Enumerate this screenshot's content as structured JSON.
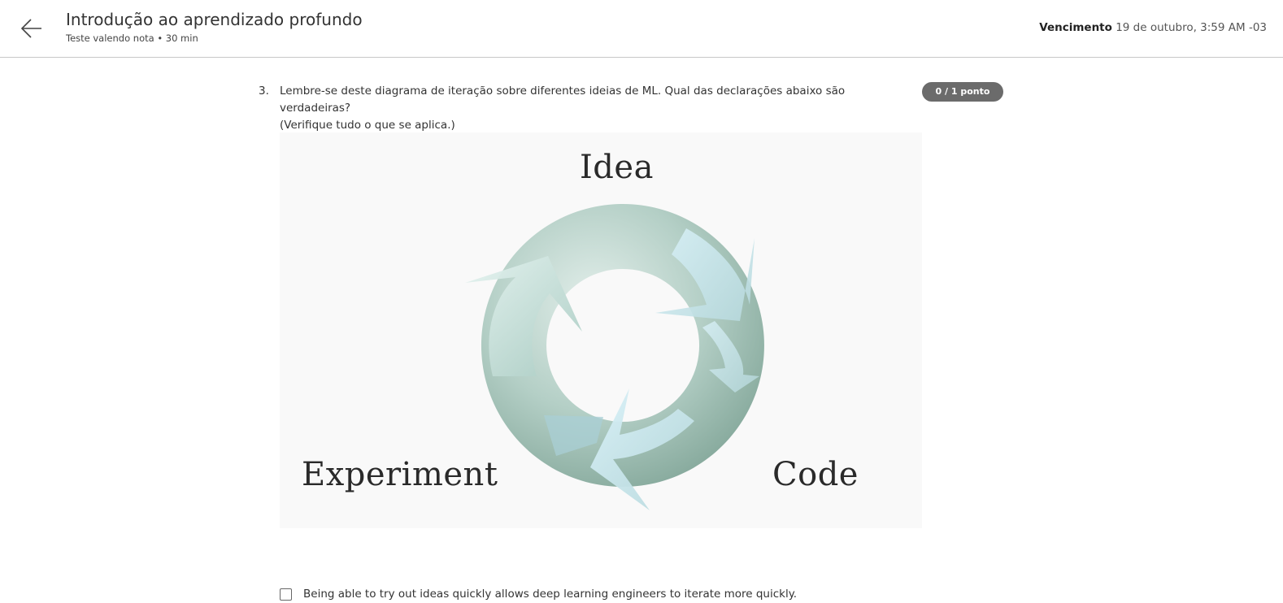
{
  "header": {
    "title": "Introdução ao aprendizado profundo",
    "subtitle": "Teste valendo nota • 30 min",
    "due_label": "Vencimento",
    "due_value": "19 de outubro, 3:59 AM -03"
  },
  "question": {
    "number": "3.",
    "text_line1": "Lembre-se deste diagrama de iteração sobre diferentes ideias de ML. Qual das declarações abaixo são verdadeiras?",
    "text_line2": "(Verifique tudo o que se aplica.)",
    "points": "0 / 1 ponto"
  },
  "diagram": {
    "labels": {
      "idea": "Idea",
      "experiment": "Experiment",
      "code": "Code"
    },
    "colors": {
      "ring_dark": "#8fb2a6",
      "ring_light": "#cfe2dc",
      "arrow_light": "#d4eef6"
    }
  },
  "options": [
    {
      "label": "Being able to try out ideas quickly allows deep learning engineers to iterate more quickly.",
      "checked": false
    }
  ]
}
